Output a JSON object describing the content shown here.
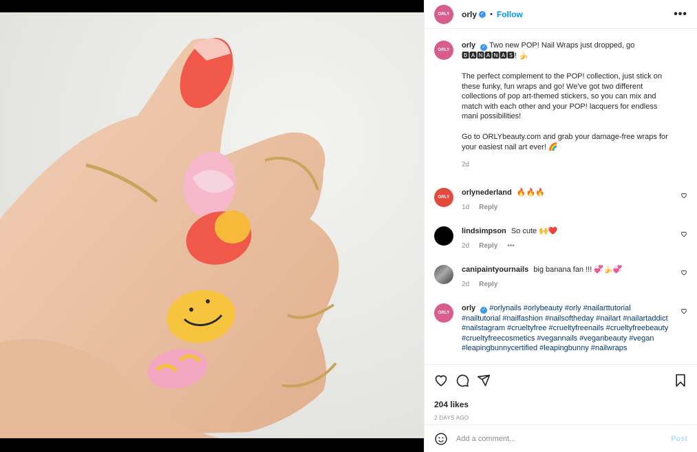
{
  "header": {
    "avatar_text": "ORLY",
    "username": "orly",
    "dot": "•",
    "follow_label": "Follow",
    "more_icon": "more-horizontal-icon"
  },
  "caption": {
    "avatar_text": "ORLY",
    "username": "orly",
    "line1": "Two new POP! Nail Wraps just dropped, go 🅱🅰🅽🅰🅽🅰🆂! 🍌",
    "separator1": "⠀⠀⠀⠀⠀⠀⠀⠀⠀⠀",
    "paragraph": "The perfect complement to the POP! collection, just stick on these funky, fun wraps and go! We've got two different collections of pop art-themed stickers, so you can mix and match with each other and your POP! lacquers for endless mani possibilities!",
    "separator2": "⠀⠀⠀⠀⠀⠀⠀⠀⠀⠀",
    "cta": "Go to ORLYbeauty.com and grab your damage-free wraps for your easiest nail art ever! 🌈",
    "time": "2d"
  },
  "comments": [
    {
      "avatar_text": "ORLY",
      "username": "orlynederland",
      "text": "🔥🔥🔥",
      "time": "1d",
      "reply": "Reply"
    },
    {
      "avatar_text": "",
      "username": "lindsimpson",
      "text": "So cute 🙌❤️",
      "time": "2d",
      "reply": "Reply",
      "more": "•••"
    },
    {
      "avatar_text": "",
      "username": "canipaintyournails",
      "text": "big banana fan !!! 💞🍌💞",
      "time": "2d",
      "reply": "Reply"
    }
  ],
  "hashtag_comment": {
    "avatar_text": "ORLY",
    "username": "orly",
    "hashtags": "#orlynails #orlybeauty #orly #nailarttutorial #nailtutorial #nailfashion #nailsoftheday #nailart #nailartaddict #nailstagram #crueltyfree #crueltyfreenails #crueltyfreebeauty #crueltyfreecosmetics #vegannails #veganbeauty #vegan #leapingbunnycertified #leapingbunny #nailwraps"
  },
  "actions": {
    "like_icon": "heart-icon",
    "comment_icon": "comment-icon",
    "share_icon": "paper-plane-icon",
    "save_icon": "bookmark-icon",
    "likes": "204 likes",
    "date": "2 DAYS AGO"
  },
  "add_comment": {
    "placeholder": "Add a comment...",
    "post_label": "Post"
  },
  "colors": {
    "accent": "#0095f6",
    "brand_pink": "#d85c8e",
    "link": "#00376b"
  }
}
